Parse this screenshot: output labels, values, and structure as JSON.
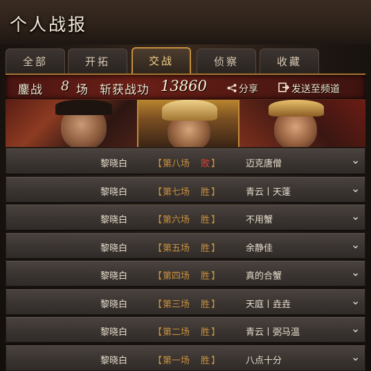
{
  "title": "个人战报",
  "tabs": [
    {
      "label": "全部",
      "active": false
    },
    {
      "label": "开拓",
      "active": false
    },
    {
      "label": "交战",
      "active": true
    },
    {
      "label": "侦察",
      "active": false
    },
    {
      "label": "收藏",
      "active": false
    }
  ],
  "summary": {
    "battle_label": "鏖战",
    "battle_count": "8",
    "battle_unit": "场",
    "merit_label": "斩获战功",
    "merit_value": "13860",
    "share_label": "分享",
    "send_label": "发送至频道"
  },
  "rows": [
    {
      "player": "黎晓白",
      "bracket_left": "【",
      "match": "第八场",
      "result": "败",
      "bracket_right": "】",
      "opponent": "迈克唐僧"
    },
    {
      "player": "黎晓白",
      "bracket_left": "【",
      "match": "第七场",
      "result": "胜",
      "bracket_right": "】",
      "opponent": "青云丨天蓬"
    },
    {
      "player": "黎晓白",
      "bracket_left": "【",
      "match": "第六场",
      "result": "胜",
      "bracket_right": "】",
      "opponent": "不用蟹"
    },
    {
      "player": "黎晓白",
      "bracket_left": "【",
      "match": "第五场",
      "result": "胜",
      "bracket_right": "】",
      "opponent": "余静佳"
    },
    {
      "player": "黎晓白",
      "bracket_left": "【",
      "match": "第四场",
      "result": "胜",
      "bracket_right": "】",
      "opponent": "真的合蟹"
    },
    {
      "player": "黎晓白",
      "bracket_left": "【",
      "match": "第三场",
      "result": "胜",
      "bracket_right": "】",
      "opponent": "天庭丨垚垚"
    },
    {
      "player": "黎晓白",
      "bracket_left": "【",
      "match": "第二场",
      "result": "胜",
      "bracket_right": "】",
      "opponent": "青云丨弼马温"
    },
    {
      "player": "黎晓白",
      "bracket_left": "【",
      "match": "第一场",
      "result": "胜",
      "bracket_right": "】",
      "opponent": "八点十分"
    }
  ],
  "icons": {
    "share": "share-icon",
    "send": "send-to-channel-icon",
    "expand": "chevron-down-icon"
  },
  "colors": {
    "win": "#c8913e",
    "lose": "#e0473a",
    "accent": "#c8913e"
  }
}
